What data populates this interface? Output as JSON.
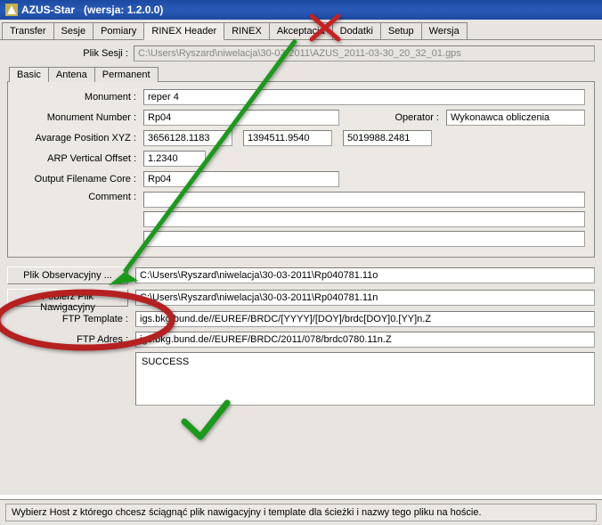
{
  "window": {
    "title": "AZUS-Star",
    "version_label": "(wersja: 1.2.0.0)"
  },
  "tabs": {
    "transfer": "Transfer",
    "sesje": "Sesje",
    "pomiary": "Pomiary",
    "rinex_header": "RINEX Header",
    "rinex": "RINEX",
    "akceptacja": "Akceptacja",
    "dodatki": "Dodatki",
    "setup": "Setup",
    "wersja": "Wersja"
  },
  "session": {
    "label": "Plik Sesji :",
    "value": "C:\\Users\\Ryszard\\niwelacja\\30-03-2011\\AZUS_2011-03-30_20_32_01.gps"
  },
  "sub_tabs": {
    "basic": "Basic",
    "antena": "Antena",
    "permanent": "Permanent"
  },
  "form": {
    "monument_label": "Monument :",
    "monument_value": "reper 4",
    "monument_number_label": "Monument Number :",
    "monument_number_value": "Rp04",
    "operator_label": "Operator :",
    "operator_value": "Wykonawca obliczenia",
    "avg_pos_label": "Avarage Position XYZ :",
    "avg_x": "3656128.1183",
    "avg_y": "1394511.9540",
    "avg_z": "5019988.2481",
    "arp_label": "ARP Vertical Offset :",
    "arp_value": "1.2340",
    "output_label": "Output Filename Core :",
    "output_value": "Rp04",
    "comment_label": "Comment :",
    "comment_value": ""
  },
  "files": {
    "obs_btn": "Plik Observacyjny ...",
    "obs_value": "C:\\Users\\Ryszard\\niwelacja\\30-03-2011\\Rp040781.11o",
    "nav_btn": "Pobierz Plik Nawigacyjny",
    "nav_value": "C:\\Users\\Ryszard\\niwelacja\\30-03-2011\\Rp040781.11n",
    "ftp_template_label": "FTP Template :",
    "ftp_template_value": "igs.bkg.bund.de//EUREF/BRDC/[YYYY]/[DOY]/brdc[DOY]0.[YY]n.Z",
    "ftp_adres_label": "FTP Adres :",
    "ftp_adres_value": "igs.bkg.bund.de//EUREF/BRDC/2011/078/brdc0780.11n.Z",
    "success": "SUCCESS"
  },
  "status_bar": "Wybierz Host z którego chcesz ściągnąć plik nawigacyjny i template dla ścieżki i nazwy tego pliku na hoście."
}
